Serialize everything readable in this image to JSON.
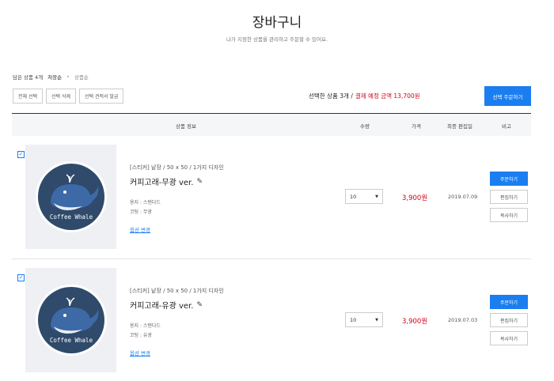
{
  "page": {
    "title": "장바구니",
    "subtitle": "나가 지정한 상품을 관리하고 주문할 수 있어요."
  },
  "meta": {
    "count_label": "담은 상품 4개",
    "sort_active": "저장순",
    "sort_dot": "•",
    "sort_other": "상품순"
  },
  "actions": {
    "select_all": "전체 선택",
    "delete_selected": "선택 삭제",
    "estimate_selected": "선택 견적서 발급"
  },
  "summary": {
    "selected_label": "선택한 상품 3개 /",
    "payment_label": "결제 예정 금액 13,700원",
    "order_button": "선택 주문하기"
  },
  "table": {
    "headers": {
      "product_info": "상품 정보",
      "quantity": "수량",
      "price": "가격",
      "edited_date": "최종 편집일",
      "note": "비고"
    }
  },
  "items": [
    {
      "checked_mark": "✓",
      "category": "[스티커] 낱장 / 50 x 50 / 1가지 디자인",
      "name": "커피고래-무광 ver.",
      "option_paper": "용지 : 스탠다드",
      "option_coating": "코팅 : 무광",
      "option_change": "옵션 변경",
      "quantity": "10",
      "price": "3,900원",
      "date": "2019.07.09",
      "btn_order": "주문하기",
      "btn_edit": "편집하기",
      "btn_copy": "복사하기",
      "thumb_text": "Coffee Whale"
    },
    {
      "checked_mark": "✓",
      "category": "[스티커] 낱장 / 50 x 50 / 1가지 디자인",
      "name": "커피고래-유광 ver.",
      "option_paper": "용지 : 스탠다드",
      "option_coating": "코팅 : 유광",
      "option_change": "옵션 변경",
      "quantity": "10",
      "price": "3,900원",
      "date": "2019.07.03",
      "btn_order": "주문하기",
      "btn_edit": "편집하기",
      "btn_copy": "복사하기",
      "thumb_text": "Coffee Whale"
    }
  ],
  "colors": {
    "accent": "#1a7ef0",
    "price_red": "#d0021b",
    "whale_body": "#3d5a88",
    "whale_circle": "#2f4a6b"
  }
}
